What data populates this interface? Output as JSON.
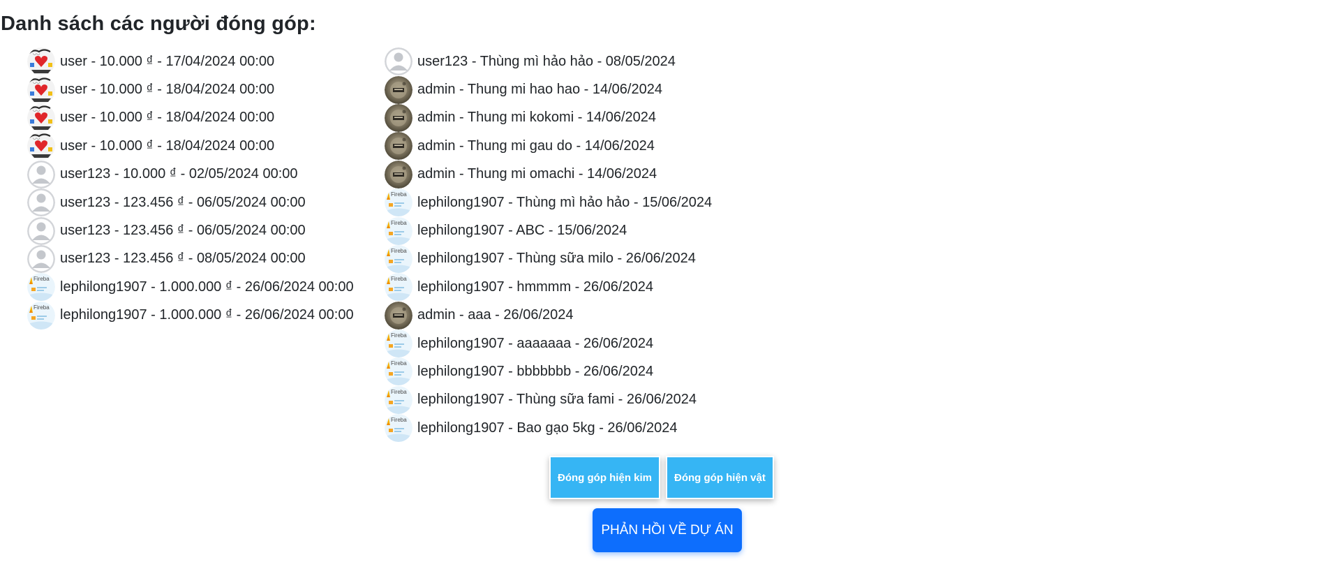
{
  "page": {
    "title": "Danh sách các người đóng góp:"
  },
  "cash_contributions": [
    {
      "avatar": "sticker-avatar",
      "text": "user - 10.000 ₫ - 17/04/2024 00:00"
    },
    {
      "avatar": "sticker-avatar",
      "text": "user - 10.000 ₫ - 18/04/2024 00:00"
    },
    {
      "avatar": "sticker-avatar",
      "text": "user - 10.000 ₫ - 18/04/2024 00:00"
    },
    {
      "avatar": "sticker-avatar",
      "text": "user - 10.000 ₫ - 18/04/2024 00:00"
    },
    {
      "avatar": "default-avatar",
      "text": "user123 - 10.000 ₫ - 02/05/2024 00:00"
    },
    {
      "avatar": "default-avatar",
      "text": "user123 - 123.456 ₫ - 06/05/2024 00:00"
    },
    {
      "avatar": "default-avatar",
      "text": "user123 - 123.456 ₫ - 06/05/2024 00:00"
    },
    {
      "avatar": "default-avatar",
      "text": "user123 - 123.456 ₫ - 08/05/2024 00:00"
    },
    {
      "avatar": "firebase-avatar",
      "text": "lephilong1907 - 1.000.000 ₫ - 26/06/2024 00:00"
    },
    {
      "avatar": "firebase-avatar",
      "text": "lephilong1907 - 1.000.000 ₫ - 26/06/2024 00:00"
    }
  ],
  "item_contributions": [
    {
      "avatar": "default-avatar",
      "text": "user123 - Thùng mì hảo hảo - 08/05/2024"
    },
    {
      "avatar": "photo-avatar",
      "text": "admin - Thung mi hao hao - 14/06/2024"
    },
    {
      "avatar": "photo-avatar",
      "text": "admin - Thung mi kokomi - 14/06/2024"
    },
    {
      "avatar": "photo-avatar",
      "text": "admin - Thung mi gau do - 14/06/2024"
    },
    {
      "avatar": "photo-avatar",
      "text": "admin - Thung mi omachi - 14/06/2024"
    },
    {
      "avatar": "firebase-avatar",
      "text": "lephilong1907 - Thùng mì hảo hảo - 15/06/2024"
    },
    {
      "avatar": "firebase-avatar",
      "text": "lephilong1907 - ABC - 15/06/2024"
    },
    {
      "avatar": "firebase-avatar",
      "text": "lephilong1907 - Thùng sữa milo - 26/06/2024"
    },
    {
      "avatar": "firebase-avatar",
      "text": "lephilong1907 - hmmmm - 26/06/2024"
    },
    {
      "avatar": "photo-avatar",
      "text": "admin - aaa - 26/06/2024"
    },
    {
      "avatar": "firebase-avatar",
      "text": "lephilong1907 - aaaaaaa - 26/06/2024"
    },
    {
      "avatar": "firebase-avatar",
      "text": "lephilong1907 - bbbbbbb - 26/06/2024"
    },
    {
      "avatar": "firebase-avatar",
      "text": "lephilong1907 - Thùng sữa fami - 26/06/2024"
    },
    {
      "avatar": "firebase-avatar",
      "text": "lephilong1907 - Bao gạo 5kg - 26/06/2024"
    }
  ],
  "actions": {
    "cash_button_label": "Đóng góp hiện kim",
    "item_button_label": "Đóng góp hiện vật",
    "feedback_button_label": "PHẢN HỒI VỀ DỰ ÁN"
  },
  "avatar_text": {
    "firebase": "Fireba"
  },
  "colors": {
    "accent_light": "#36b5f4",
    "accent_primary": "#0d6efd",
    "text": "#212529"
  }
}
